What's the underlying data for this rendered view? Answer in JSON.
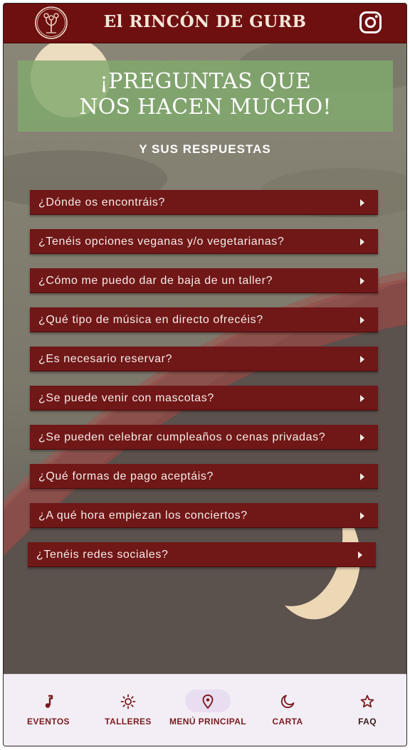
{
  "header": {
    "title": "El RINCÓN DE GURB",
    "logo_icon": "gurb-logo-icon",
    "social_icon": "instagram-icon"
  },
  "hero": {
    "title_line1": "¡PREGUNTAS QUE",
    "title_line2": "NOS HACEN MUCHO!",
    "subtitle": "Y SUS RESPUESTAS"
  },
  "faq": {
    "items": [
      {
        "question": "¿Dónde os encontráis?"
      },
      {
        "question": "¿Tenéis opciones veganas y/o vegetarianas?"
      },
      {
        "question": "¿Cómo me puedo dar de baja de un taller?"
      },
      {
        "question": "¿Qué tipo de música en directo ofrecéis?"
      },
      {
        "question": "¿Es necesario reservar?"
      },
      {
        "question": "¿Se puede venir con mascotas?"
      },
      {
        "question": "¿Se pueden celebrar cumpleaños o cenas privadas?"
      },
      {
        "question": "¿Qué formas de pago aceptáis?"
      },
      {
        "question": "¿A qué hora empiezan los conciertos?"
      },
      {
        "question": "¿Tenéis redes sociales?"
      }
    ]
  },
  "nav": {
    "items": [
      {
        "label": "EVENTOS",
        "icon": "music-note-icon"
      },
      {
        "label": "TALLERES",
        "icon": "sun-icon"
      },
      {
        "label": "MENÚ PRINCIPAL",
        "icon": "location-pin-icon",
        "active": true
      },
      {
        "label": "CARTA",
        "icon": "moon-icon"
      },
      {
        "label": "FAQ",
        "icon": "star-icon"
      }
    ]
  },
  "colors": {
    "brand_red": "#6e0f10",
    "item_red": "#701718",
    "hero_green": "#80aa6c",
    "nav_bg": "#f3eef5",
    "nav_active_pill": "#e9ddf2"
  }
}
